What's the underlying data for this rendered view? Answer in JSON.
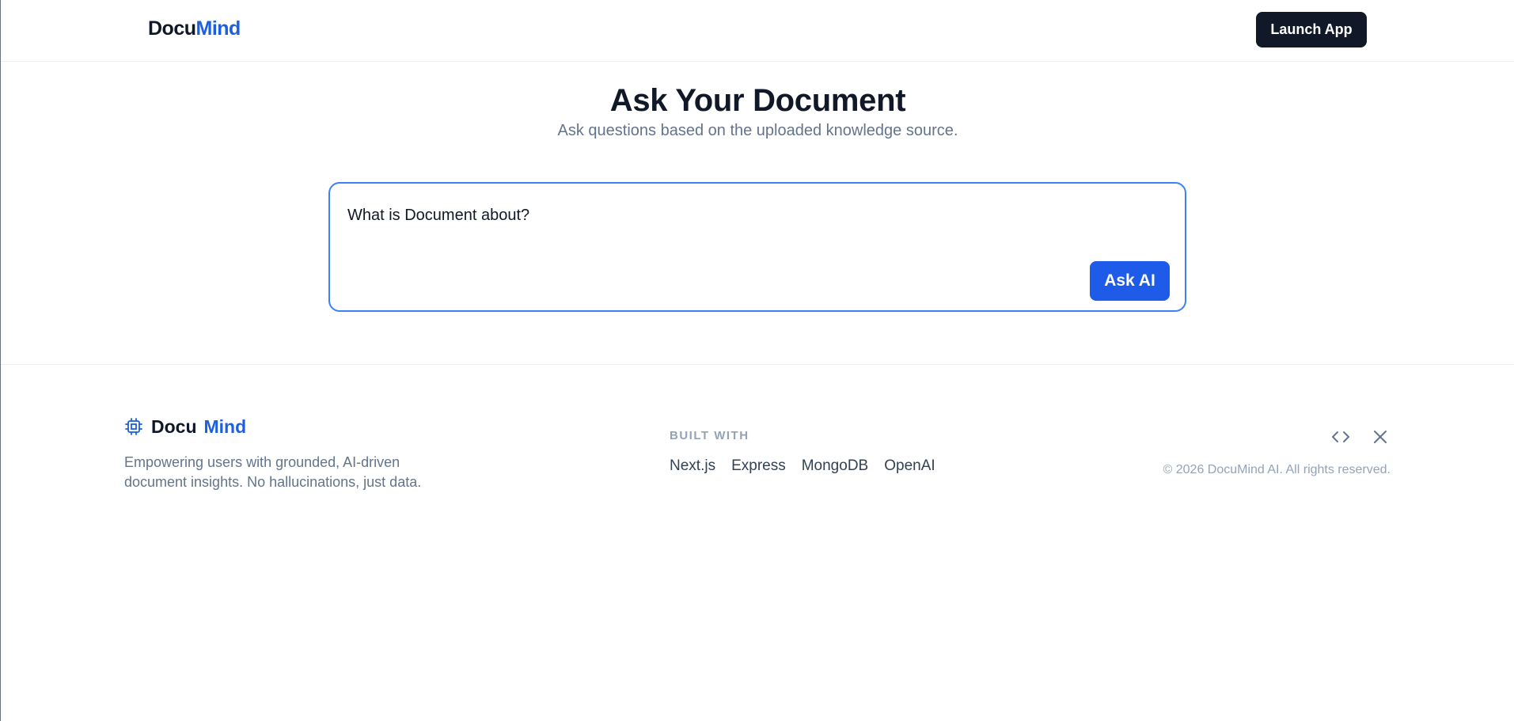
{
  "header": {
    "brand_part1": "Docu",
    "brand_part2": "Mind",
    "launch_label": "Launch App"
  },
  "main": {
    "title": "Ask Your Document",
    "subtitle": "Ask questions based on the uploaded knowledge source.",
    "question_value": "What is Document about?",
    "ask_label": "Ask AI"
  },
  "footer": {
    "brand_part1": "Docu",
    "brand_part2": "Mind",
    "brand_icon": "chip-icon",
    "description": "Empowering users with grounded, AI-driven document insights. No hallucinations, just data.",
    "built_with_label": "BUILT WITH",
    "tech": [
      "Next.js",
      "Express",
      "MongoDB",
      "OpenAI"
    ],
    "social_icons": [
      "code-icon",
      "x-icon"
    ],
    "copyright": "© 2026 DocuMind AI. All rights reserved."
  },
  "colors": {
    "brand_blue": "#1d5fe0",
    "dark": "#111827",
    "accent_border": "#3b82f6"
  }
}
